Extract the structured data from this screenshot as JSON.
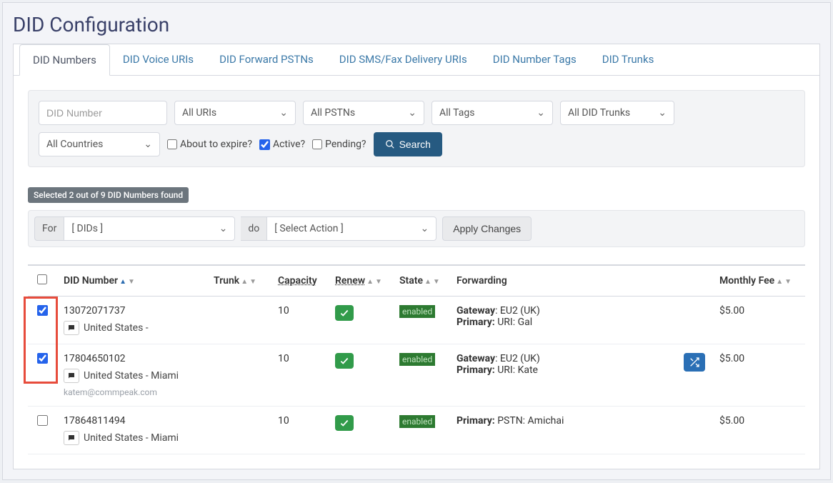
{
  "page": {
    "title": "DID Configuration"
  },
  "tabs": [
    {
      "label": "DID Numbers",
      "active": true
    },
    {
      "label": "DID Voice URIs"
    },
    {
      "label": "DID Forward PSTNs"
    },
    {
      "label": "DID SMS/Fax Delivery URIs"
    },
    {
      "label": "DID Number Tags"
    },
    {
      "label": "DID Trunks"
    }
  ],
  "filters": {
    "did_placeholder": "DID Number",
    "uris": "All URIs",
    "pstns": "All PSTNs",
    "tags": "All Tags",
    "trunks": "All DID Trunks",
    "countries": "All Countries",
    "expire_label": "About to expire?",
    "active_label": "Active?",
    "pending_label": "Pending?",
    "active_checked": true,
    "search": "Search"
  },
  "summary": {
    "text": "Selected 2 out of 9 DID Numbers found"
  },
  "actionbar": {
    "for_label": "For",
    "for_value": "[ DIDs ]",
    "do_label": "do",
    "do_value": "[ Select Action ]",
    "apply": "Apply Changes"
  },
  "columns": {
    "did": "DID Number",
    "trunk": "Trunk",
    "capacity": "Capacity",
    "renew": "Renew",
    "state": "State",
    "forwarding": "Forwarding",
    "fee": "Monthly Fee"
  },
  "rows": [
    {
      "checked": true,
      "number": "13072071737",
      "region": "United States -",
      "capacity": "10",
      "renew": true,
      "state": "enabled",
      "gateway_label": "Gateway",
      "gateway_value": ": EU2 (UK)",
      "primary_label": "Primary:",
      "primary_value": " URI: Gal",
      "fee": "$5.00",
      "shuffle": false
    },
    {
      "checked": true,
      "number": "17804650102",
      "region": "United States - Miami",
      "email": "katem@commpeak.com",
      "capacity": "10",
      "renew": true,
      "state": "enabled",
      "gateway_label": "Gateway",
      "gateway_value": ": EU2 (UK)",
      "primary_label": "Primary:",
      "primary_value": " URI: Kate",
      "fee": "$5.00",
      "shuffle": true
    },
    {
      "checked": false,
      "number": "17864811494",
      "region": "United States - Miami",
      "capacity": "10",
      "renew": true,
      "state": "enabled",
      "primary_label": "Primary:",
      "primary_value": " PSTN: Amichai",
      "fee": "$5.00",
      "shuffle": false
    }
  ]
}
